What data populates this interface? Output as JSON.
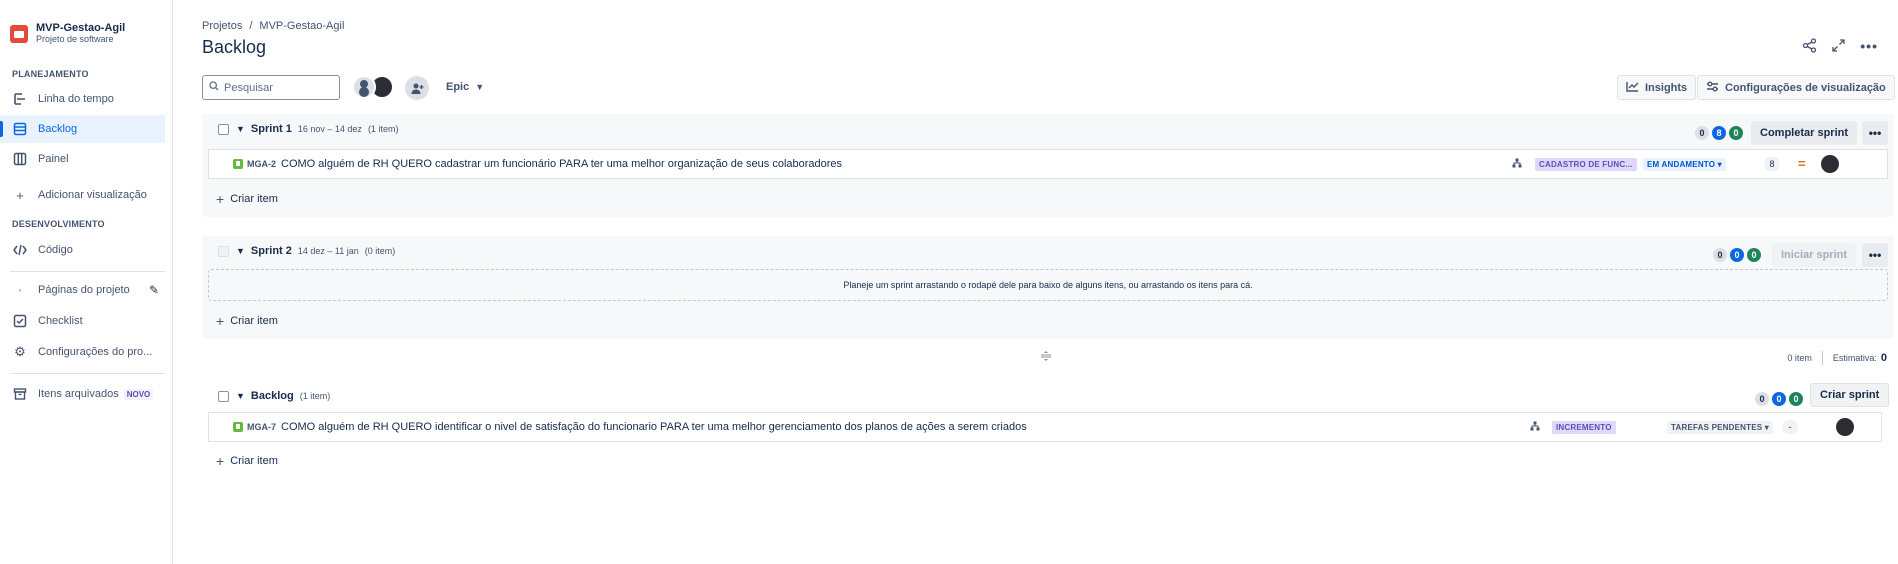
{
  "project": {
    "name": "MVP-Gestao-Agil",
    "type": "Projeto de software"
  },
  "sidebar": {
    "planning_header": "PLANEJAMENTO",
    "planning_items": [
      {
        "label": "Linha do tempo",
        "icon": "timeline-icon"
      },
      {
        "label": "Backlog",
        "icon": "backlog-icon",
        "active": true
      },
      {
        "label": "Painel",
        "icon": "board-icon"
      },
      {
        "label": "Adicionar visualização",
        "icon": "plus-icon"
      }
    ],
    "dev_header": "DESENVOLVIMENTO",
    "dev_items": [
      {
        "label": "Código",
        "icon": "code-icon"
      }
    ],
    "other_items": [
      {
        "label": "Páginas do projeto",
        "icon": "pages-icon"
      },
      {
        "label": "Checklist",
        "icon": "checklist-icon"
      },
      {
        "label": "Configurações do pro...",
        "icon": "gear-icon"
      }
    ],
    "archived": {
      "label": "Itens arquivados",
      "badge": "NOVO",
      "icon": "archive-icon"
    }
  },
  "breadcrumb": {
    "root": "Projetos",
    "separator": "/",
    "project": "MVP-Gestao-Agil"
  },
  "page_title": "Backlog",
  "toolbar": {
    "search_placeholder": "Pesquisar",
    "epic_label": "Epic",
    "insights_label": "Insights",
    "view_settings_label": "Configurações de visualização"
  },
  "sprint1": {
    "name": "Sprint 1",
    "dates": "16 nov – 14 dez",
    "count": "(1 item)",
    "counts": {
      "todo": "0",
      "in_progress": "8",
      "done": "0"
    },
    "action": "Completar sprint",
    "issue": {
      "key": "MGA-2",
      "summary": "COMO alguém de RH QUERO cadastrar um funcionário PARA ter uma melhor organização de seus colaboradores",
      "epic": "CADASTRO DE FUNC...",
      "status": "EM ANDAMENTO",
      "points": "8",
      "accent": "#e56910"
    },
    "create_label": "Criar item"
  },
  "sprint2": {
    "name": "Sprint 2",
    "dates": "14 dez – 11 jan",
    "count": "(0 item)",
    "counts": {
      "todo": "0",
      "in_progress": "0",
      "done": "0"
    },
    "action": "Iniciar sprint",
    "empty_text": "Planeje um sprint arrastando o rodapé dele para baixo de alguns itens, ou arrastando os itens para cá.",
    "create_label": "Criar item"
  },
  "backlog_summary": {
    "items": "0 item",
    "estimate_label": "Estimativa:",
    "estimate_value": "0"
  },
  "backlog": {
    "name": "Backlog",
    "count": "(1 item)",
    "counts": {
      "todo": "0",
      "in_progress": "0",
      "done": "0"
    },
    "action": "Criar sprint",
    "issue": {
      "key": "MGA-7",
      "summary": "COMO alguém de RH QUERO identificar o nivel de satisfação do funcionario PARA ter uma melhor gerenciamento dos planos de ações a serem criados",
      "epic": "INCREMENTO",
      "status": "TAREFAS PENDENTES",
      "points": "-"
    },
    "create_label": "Criar item"
  }
}
